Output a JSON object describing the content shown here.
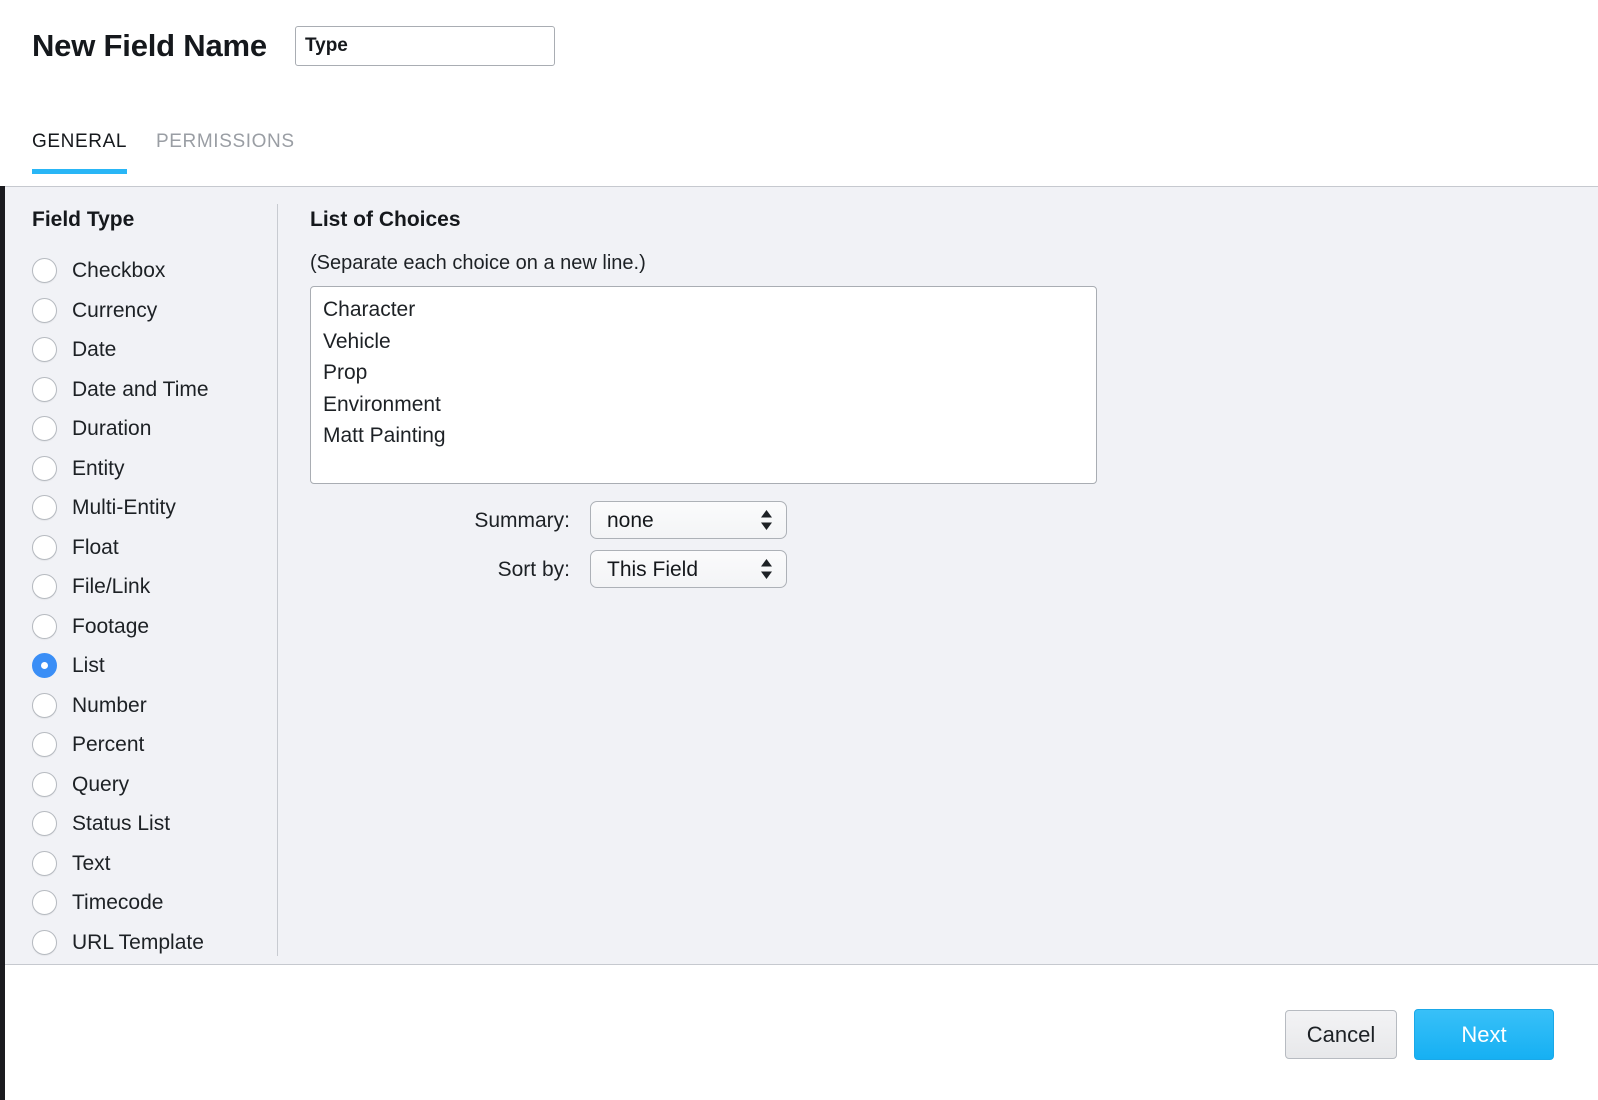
{
  "header": {
    "page_title": "New Field Name",
    "field_name_value": "Type",
    "field_name_placeholder": "Field Name"
  },
  "tabs": [
    {
      "label": "GENERAL",
      "active": true
    },
    {
      "label": "PERMISSIONS",
      "active": false
    }
  ],
  "sidebar": {
    "heading": "Field Type",
    "selected": "List",
    "items": [
      {
        "label": "Checkbox"
      },
      {
        "label": "Currency"
      },
      {
        "label": "Date"
      },
      {
        "label": "Date and Time"
      },
      {
        "label": "Duration"
      },
      {
        "label": "Entity"
      },
      {
        "label": "Multi-Entity"
      },
      {
        "label": "Float"
      },
      {
        "label": "File/Link"
      },
      {
        "label": "Footage"
      },
      {
        "label": "List"
      },
      {
        "label": "Number"
      },
      {
        "label": "Percent"
      },
      {
        "label": "Query"
      },
      {
        "label": "Status List"
      },
      {
        "label": "Text"
      },
      {
        "label": "Timecode"
      },
      {
        "label": "URL Template"
      }
    ]
  },
  "content": {
    "choices_heading": "List of Choices",
    "choices_hint": "(Separate each choice on a new line.)",
    "choices_value": "Character\nVehicle\nProp\nEnvironment\nMatt Painting",
    "choices_placeholder": "",
    "summary": {
      "label": "Summary:",
      "value": "none"
    },
    "sort_by": {
      "label": "Sort by:",
      "value": "This Field"
    }
  },
  "footer": {
    "cancel_label": "Cancel",
    "next_label": "Next"
  },
  "colors": {
    "accent_blue": "#29b6f6",
    "radio_selected": "#3a8ef6",
    "panel_background": "#f1f2f6",
    "next_button": "#16b0f3"
  }
}
